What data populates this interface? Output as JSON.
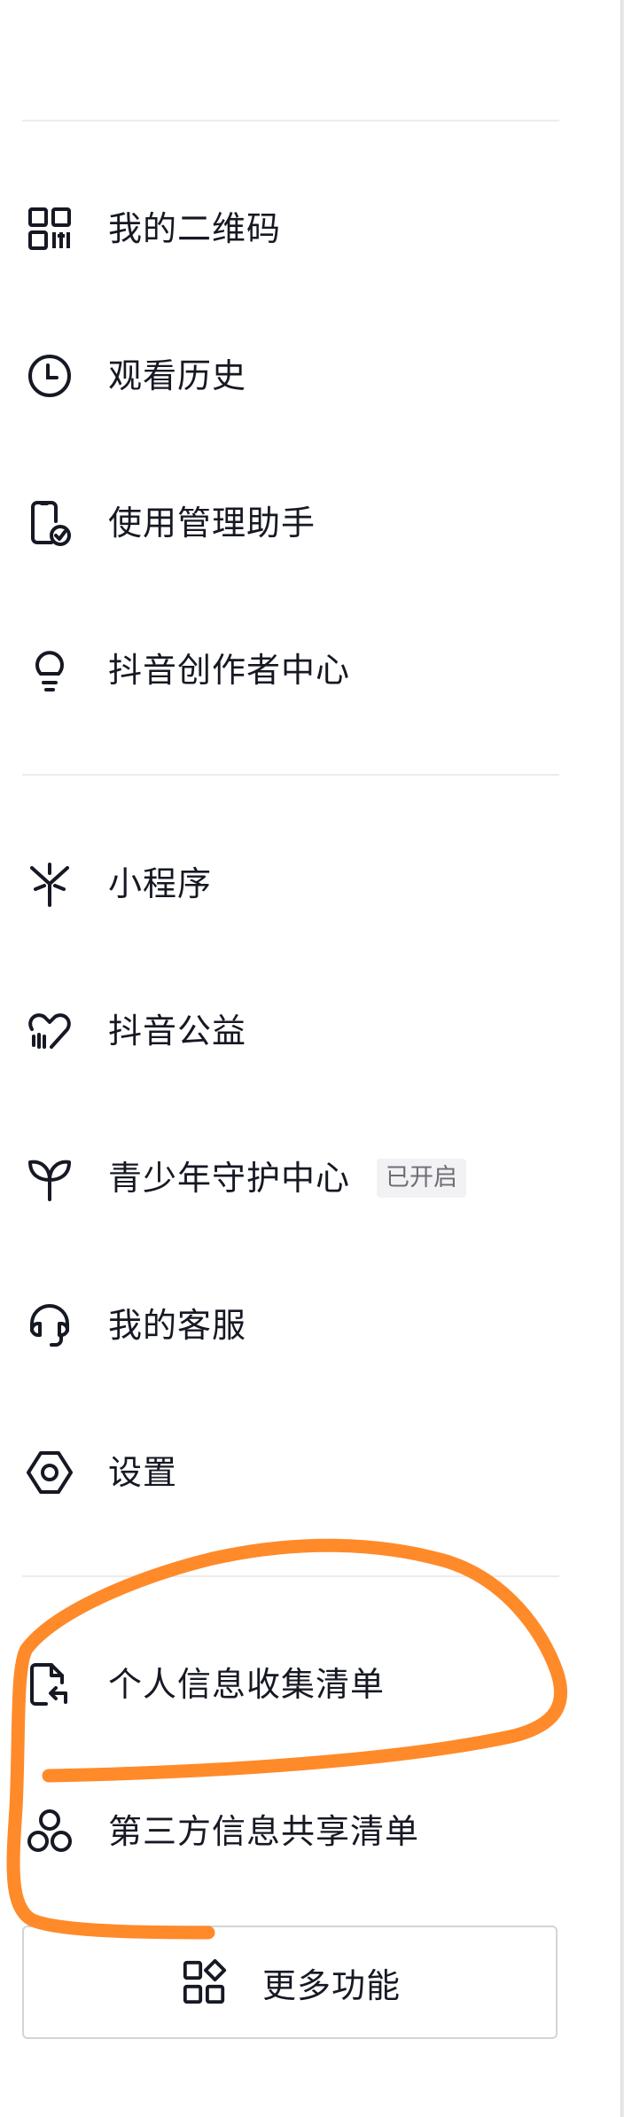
{
  "menu": {
    "group1": [
      {
        "label": "我的二维码",
        "icon": "qr-code-icon"
      },
      {
        "label": "观看历史",
        "icon": "clock-icon"
      },
      {
        "label": "使用管理助手",
        "icon": "phone-check-icon"
      },
      {
        "label": "抖音创作者中心",
        "icon": "lightbulb-icon"
      }
    ],
    "group2": [
      {
        "label": "小程序",
        "icon": "mini-program-icon"
      },
      {
        "label": "抖音公益",
        "icon": "heart-hands-icon"
      },
      {
        "label": "青少年守护中心",
        "icon": "sprout-icon",
        "badge": "已开启"
      },
      {
        "label": "我的客服",
        "icon": "headset-icon"
      },
      {
        "label": "设置",
        "icon": "settings-hexagon-icon"
      }
    ],
    "group3": [
      {
        "label": "个人信息收集清单",
        "icon": "file-return-icon"
      },
      {
        "label": "第三方信息共享清单",
        "icon": "share-nodes-icon"
      }
    ],
    "more_button": {
      "label": "更多功能",
      "icon": "grid-diamond-icon"
    }
  },
  "colors": {
    "text": "#161823",
    "divider": "#ececee",
    "badge_bg": "#f2f2f4",
    "badge_text": "#6e6f75",
    "annotation": "#ff8a2a"
  }
}
